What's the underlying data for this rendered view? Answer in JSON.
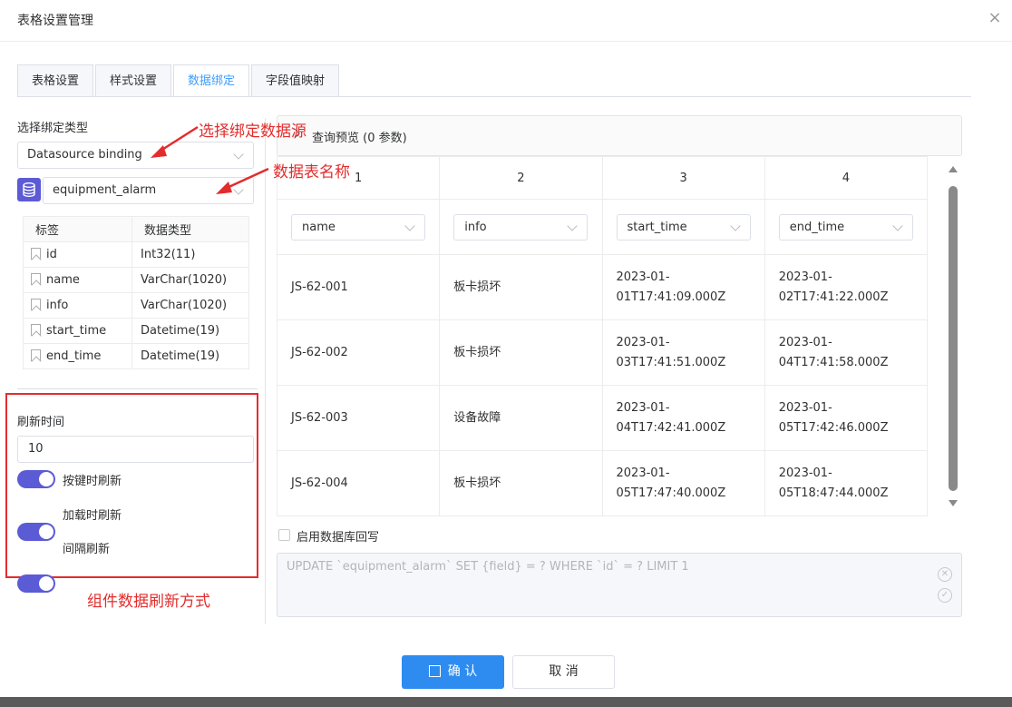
{
  "dialog": {
    "title": "表格设置管理",
    "close": "×"
  },
  "tabs": [
    "表格设置",
    "样式设置",
    "数据绑定",
    "字段值映射"
  ],
  "left": {
    "binding_type_label": "选择绑定类型",
    "binding_type_value": "Datasource binding",
    "table_name": "equipment_alarm",
    "field_headers": [
      "标签",
      "数据类型"
    ],
    "fields": [
      {
        "name": "id",
        "type": "Int32(11)"
      },
      {
        "name": "name",
        "type": "VarChar(1020)"
      },
      {
        "name": "info",
        "type": "VarChar(1020)"
      },
      {
        "name": "start_time",
        "type": "Datetime(19)"
      },
      {
        "name": "end_time",
        "type": "Datetime(19)"
      }
    ],
    "refresh_label": "刷新时间",
    "refresh_value": "10",
    "switches": [
      "按键时刷新",
      "加载时刷新",
      "间隔刷新"
    ]
  },
  "annotations": {
    "datasource": "选择绑定数据源",
    "table": "数据表名称",
    "refresh": "组件数据刷新方式"
  },
  "preview": {
    "title": "查询预览 (0 参数)",
    "columns": [
      "1",
      "2",
      "3",
      "4"
    ],
    "selects": [
      "name",
      "info",
      "start_time",
      "end_time"
    ],
    "rows": [
      [
        "JS-62-001",
        "板卡损坏",
        "2023-01-\n01T17:41:09.000Z",
        "2023-01-\n02T17:41:22.000Z"
      ],
      [
        "JS-62-002",
        "板卡损坏",
        "2023-01-\n03T17:41:51.000Z",
        "2023-01-\n04T17:41:58.000Z"
      ],
      [
        "JS-62-003",
        "设备故障",
        "2023-01-\n04T17:42:41.000Z",
        "2023-01-\n05T17:42:46.000Z"
      ],
      [
        "JS-62-004",
        "板卡损坏",
        "2023-01-\n05T17:47:40.000Z",
        "2023-01-\n05T18:47:44.000Z"
      ]
    ]
  },
  "writeback": {
    "label": "启用数据库回写",
    "sql": "UPDATE `equipment_alarm` SET {field} = ? WHERE `id` = ? LIMIT 1"
  },
  "buttons": {
    "ok": "确 认",
    "cancel": "取 消"
  },
  "colors": {
    "primary": "#2e8cf0",
    "switch": "#5b5bd6",
    "annotation": "#e32c2c",
    "active_tab": "#409eff"
  }
}
